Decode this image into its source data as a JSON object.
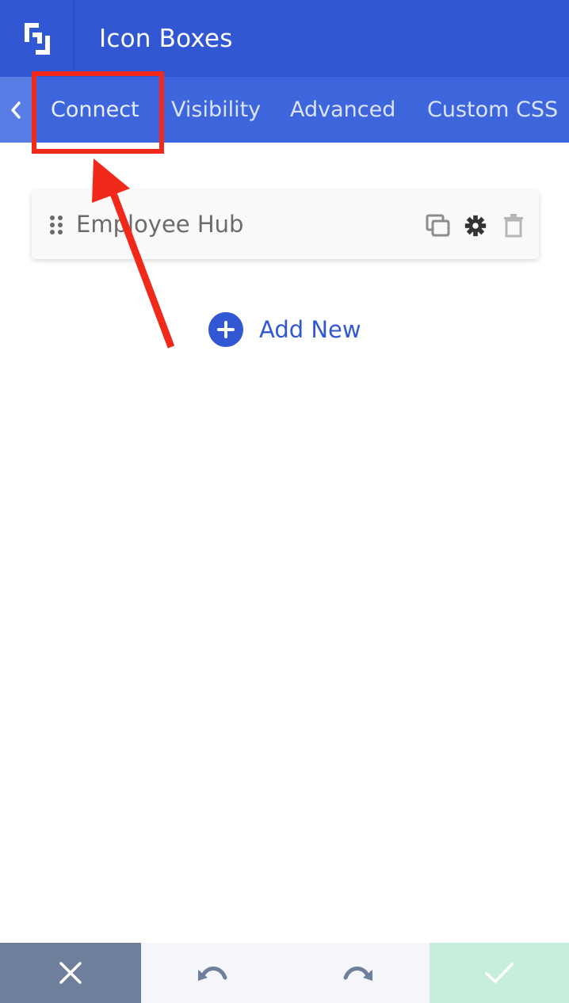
{
  "header": {
    "title": "Icon Boxes",
    "logo_icon": "brackets-logo-icon"
  },
  "tabs": [
    {
      "label": "Connect",
      "active": true
    },
    {
      "label": "Visibility"
    },
    {
      "label": "Advanced"
    },
    {
      "label": "Custom CSS"
    }
  ],
  "items": [
    {
      "label": "Employee Hub"
    }
  ],
  "add_new": {
    "label": "Add New"
  },
  "colors": {
    "header": "#3158d2",
    "tabs": "#3e66dc",
    "annotation": "#f0291b",
    "cancel": "#6d7f9b",
    "confirm": "#c5eedd"
  },
  "footer": {
    "cancel_icon": "close-icon",
    "undo_icon": "undo-icon",
    "redo_icon": "redo-icon",
    "confirm_icon": "checkmark-icon"
  }
}
